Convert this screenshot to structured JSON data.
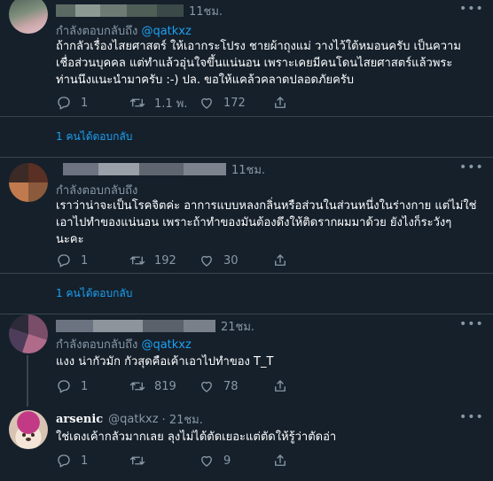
{
  "tweets": [
    {
      "time": "11ชม.",
      "reply_label": "กำลังตอบกลับถึง",
      "reply_mention": "@qatkxz",
      "text": "ถ้ากลัวเรื่องไสยศาสตร์ ให้เอากระโปรง ชายผ้าถุงแม่  วางไว้ใต้หมอนครับ เป็นความ\nเชื่อส่วนบุคคล แต่ทำแล้วอุ่นใจขึ้นแน่นอน เพราะเคยมีคนโดนไสยศาสตร์แล้วพระ\nท่านนึงแนะนำมาครับ :-)    ปล. ขอให้แคล้วคลาดปลอดภัยครับ",
      "replies": "1",
      "retweets": "1.1 พ.",
      "likes": "172",
      "show_replies": "1 คนได้ตอบกลับ"
    },
    {
      "time": "11ชม.",
      "reply_label": "กำลังตอบกลับถึง",
      "reply_mention": "",
      "text": "เราว่าน่าจะเป็นโรคจิตค่ะ อาการแบบหลงกลิ่นหรือส่วนในส่วนหนึ่งในร่างกาย แต่ไม่ใช่\nเอาไปทำของแน่นอน เพราะถ้าทำของมันต้องดึงให้ติดรากผมมาด้วย ยังไงก็ระวังๆ\nนะคะ",
      "replies": "1",
      "retweets": "192",
      "likes": "30",
      "show_replies": "1 คนได้ตอบกลับ"
    },
    {
      "time": "21ชม.",
      "reply_label": "กำลังตอบกลับถึง",
      "reply_mention": "@qatkxz",
      "text": "แงง น่ากัวมัก กัวสุดคือเค้าเอาไปทำของ T_T",
      "replies": "1",
      "retweets": "819",
      "likes": "78"
    },
    {
      "display_name": "arsenic",
      "handle": "@qatkxz",
      "time": "21ชม.",
      "text": "ใช่เดงเค้ากลัวมากเลย ลุงไม่ได้ตัดเยอะแต่ตัดให้รู้ว่าตัดอ่า",
      "replies": "1",
      "retweets": "",
      "likes": "9"
    }
  ],
  "icons": {
    "more": "more-horizontal-icon",
    "reply": "reply-icon",
    "retweet": "retweet-icon",
    "like": "heart-icon",
    "share": "share-icon"
  },
  "colors": {
    "background": "#15202b",
    "accent": "#1da1f2",
    "muted": "#8899a6",
    "divider": "#38444d"
  }
}
